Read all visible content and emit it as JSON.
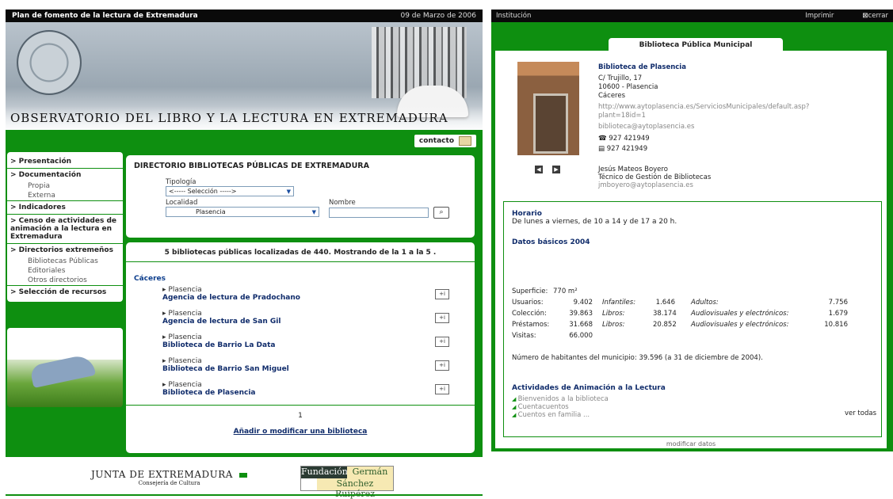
{
  "left": {
    "topbar": {
      "title": "Plan de fomento de la lectura de Extremadura",
      "date": "09 de Marzo de 2006"
    },
    "banner_title": "OBSERVATORIO DEL LIBRO Y LA LECTURA EN EXTREMADURA",
    "contact": "contacto",
    "nav": {
      "presentacion": "> Presentación",
      "documentacion": "> Documentación",
      "propia": "Propia",
      "externa": "Externa",
      "indicadores": "> Indicadores",
      "censo": "> Censo de actividades de animación a la lectura en Extremadura",
      "directorios": "> Directorios extremeños",
      "bibliotecas": "Bibliotecas Públicas",
      "editoriales": "Editoriales",
      "otros": "Otros directorios",
      "seleccion": "> Selección de recursos"
    },
    "directory": {
      "title": "DIRECTORIO BIBLIOTECAS PÚBLICAS DE EXTREMADURA",
      "tipologia_label": "Tipología",
      "tipologia_value": "<----- Selección ----->",
      "localidad_label": "Localidad",
      "localidad_value": "Plasencia",
      "nombre_label": "Nombre",
      "nombre_value": ""
    },
    "results": {
      "summary": "5 bibliotecas públicas localizadas de 440. Mostrando de la 1 a la 5 .",
      "province": "Cáceres",
      "items": [
        {
          "city": "Plasencia",
          "name": "Agencia de lectura de Pradochano",
          "info": "+i"
        },
        {
          "city": "Plasencia",
          "name": "Agencia de lectura de San Gil",
          "info": "+i"
        },
        {
          "city": "Plasencia",
          "name": "Biblioteca de Barrio La Data",
          "info": "+i"
        },
        {
          "city": "Plasencia",
          "name": "Biblioteca de Barrio San Miguel",
          "info": "+i"
        },
        {
          "city": "Plasencia",
          "name": "Biblioteca de Plasencia",
          "info": "+i"
        }
      ],
      "page": "1",
      "add_link": "Añadir o modificar una biblioteca"
    },
    "footer": {
      "junta": "JUNTA DE EXTREMADURA",
      "consejeria": "Consejería de Cultura",
      "fgsr_1": "Fundación",
      "fgsr_2": "Germán",
      "fgsr_3": "Sánchez Ruipérez"
    }
  },
  "right": {
    "topbar": {
      "institucion": "Institución",
      "imprimir": "Imprimir",
      "cerrar": "cerrar"
    },
    "tab": "Biblioteca Pública Municipal",
    "library": {
      "name": "Biblioteca de Plasencia",
      "street": "C/ Trujillo, 17",
      "postal": "10600 - Plasencia",
      "province": "Cáceres",
      "url": "http://www.aytoplasencia.es/ServiciosMunicipales/default.asp?plant=18id=1",
      "email": "biblioteca@aytoplasencia.es",
      "phone": "927 421949",
      "fax": "927 421949",
      "contact_name": "Jesús Mateos Boyero",
      "contact_role": "Técnico de Gestión de Bibliotecas",
      "contact_email": "jmboyero@aytoplasencia.es"
    },
    "horario_title": "Horario",
    "horario_text": "De lunes a viernes, de 10 a 14 y de 17 a 20 h.",
    "datos_title": "Datos básicos 2004",
    "stats": {
      "superficie_label": "Superficie:",
      "superficie_value": "770 m²",
      "usuarios_label": "Usuarios:",
      "usuarios_value": "9.402",
      "usuarios_infantiles_label": "Infantiles:",
      "usuarios_infantiles_value": "1.646",
      "usuarios_adultos_label": "Adultos:",
      "usuarios_adultos_value": "7.756",
      "coleccion_label": "Colección:",
      "coleccion_value": "39.863",
      "coleccion_libros_label": "Libros:",
      "coleccion_libros_value": "38.174",
      "coleccion_av_label": "Audiovisuales y electrónicos:",
      "coleccion_av_value": "1.679",
      "prestamos_label": "Préstamos:",
      "prestamos_value": "31.668",
      "prestamos_libros_label": "Libros:",
      "prestamos_libros_value": "20.852",
      "prestamos_av_label": "Audiovisuales y electrónicos:",
      "prestamos_av_value": "10.816",
      "visitas_label": "Visitas:",
      "visitas_value": "66.000"
    },
    "habitantes": "Número de habitantes del municipio: 39.596 (a 31 de diciembre de 2004).",
    "actividades_title": "Actividades de Animación a la Lectura",
    "actividades": [
      "Bienvenidos a la biblioteca",
      "Cuentacuentos",
      "Cuentos en familia ..."
    ],
    "ver_todas": "ver todas",
    "modificar": "modificar datos"
  }
}
